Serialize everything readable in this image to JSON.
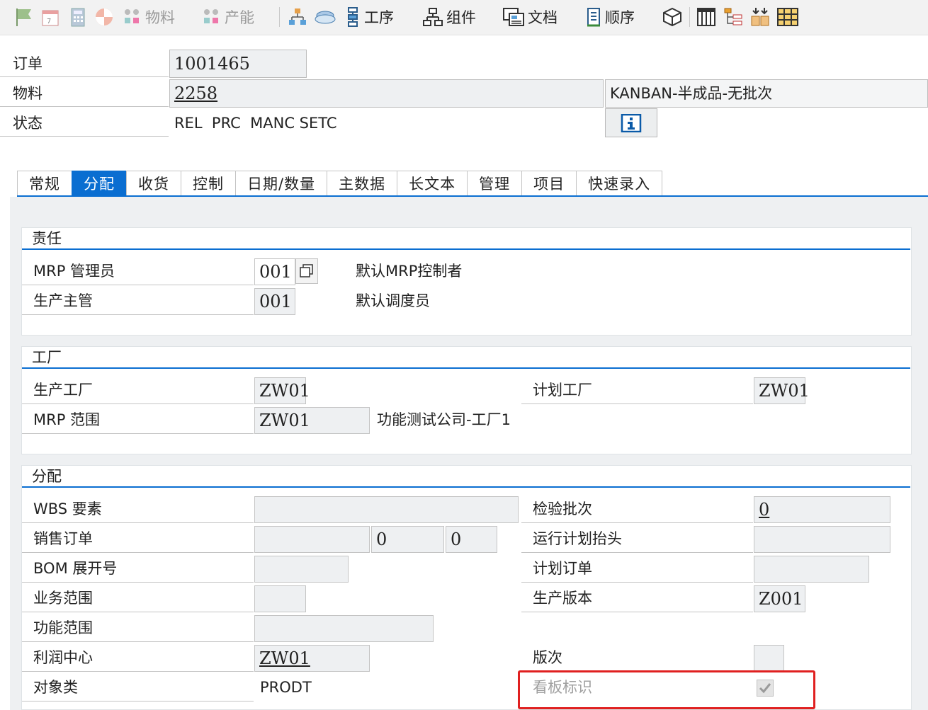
{
  "toolbar": {
    "material": "物料",
    "capacity": "产能",
    "operations": "工序",
    "components": "组件",
    "documents": "文档",
    "sequence": "顺序"
  },
  "header": {
    "order_label": "订单",
    "order_value": "1001465",
    "material_label": "物料",
    "material_value": "2258",
    "material_desc": "KANBAN-半成品-无批次",
    "status_label": "状态",
    "status_value": "REL  PRC  MANC SETC"
  },
  "tabs": [
    {
      "label": "常规"
    },
    {
      "label": "分配",
      "active": true
    },
    {
      "label": "收货"
    },
    {
      "label": "控制"
    },
    {
      "label": "日期/数量"
    },
    {
      "label": "主数据"
    },
    {
      "label": "长文本"
    },
    {
      "label": "管理"
    },
    {
      "label": "项目"
    },
    {
      "label": "快速录入"
    }
  ],
  "responsibility": {
    "title": "责任",
    "mrp_controller_label": "MRP 管理员",
    "mrp_controller_value": "001",
    "mrp_controller_desc": "默认MRP控制者",
    "prod_supervisor_label": "生产主管",
    "prod_supervisor_value": "001",
    "prod_supervisor_desc": "默认调度员"
  },
  "plant": {
    "title": "工厂",
    "prod_plant_label": "生产工厂",
    "prod_plant_value": "ZW01",
    "planning_plant_label": "计划工厂",
    "planning_plant_value": "ZW01",
    "mrp_area_label": "MRP 范围",
    "mrp_area_value": "ZW01",
    "mrp_area_desc": "功能测试公司-工厂1"
  },
  "assignment": {
    "title": "分配",
    "wbs_label": "WBS 要素",
    "wbs_value": "",
    "inspection_lot_label": "检验批次",
    "inspection_lot_value": "0",
    "sales_order_label": "销售订单",
    "sales_order_value": "",
    "sales_order_item": "0",
    "sales_order_schedule": "0",
    "run_schedule_label": "运行计划抬头",
    "run_schedule_value": "",
    "bom_expl_label": "BOM 展开号",
    "bom_expl_value": "",
    "planned_order_label": "计划订单",
    "planned_order_value": "",
    "business_area_label": "业务范围",
    "business_area_value": "",
    "production_version_label": "生产版本",
    "production_version_value": "Z001",
    "functional_area_label": "功能范围",
    "functional_area_value": "",
    "profit_center_label": "利润中心",
    "profit_center_value": "ZW01",
    "revision_label": "版次",
    "revision_value": "",
    "object_class_label": "对象类",
    "object_class_value": "PRODT",
    "kanban_label": "看板标识",
    "kanban_checked": true
  },
  "colors": {
    "accent": "#0a6ed1",
    "highlight": "#e02020"
  }
}
